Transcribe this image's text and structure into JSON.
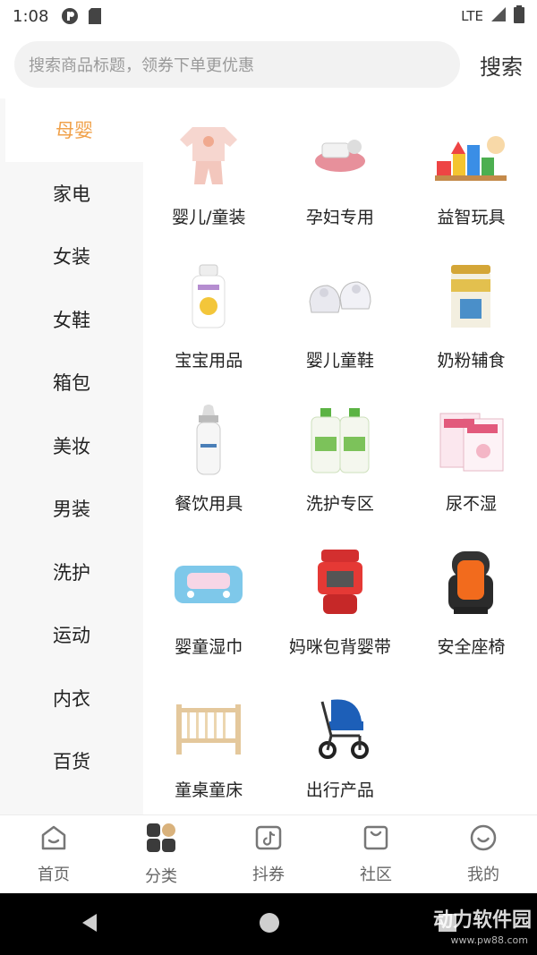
{
  "status_bar": {
    "time": "1:08",
    "network": "LTE"
  },
  "search": {
    "placeholder": "搜索商品标题，领券下单更优惠",
    "button": "搜索"
  },
  "sidebar": {
    "items": [
      {
        "label": "母婴",
        "active": true
      },
      {
        "label": "家电"
      },
      {
        "label": "女装"
      },
      {
        "label": "女鞋"
      },
      {
        "label": "箱包"
      },
      {
        "label": "美妆"
      },
      {
        "label": "男装"
      },
      {
        "label": "洗护"
      },
      {
        "label": "运动"
      },
      {
        "label": "内衣"
      },
      {
        "label": "百货"
      }
    ]
  },
  "categories": [
    {
      "label": "婴儿/童装",
      "icon": "baby-clothes-icon"
    },
    {
      "label": "孕妇专用",
      "icon": "maternity-icon"
    },
    {
      "label": "益智玩具",
      "icon": "toy-blocks-icon"
    },
    {
      "label": "宝宝用品",
      "icon": "baby-lotion-icon"
    },
    {
      "label": "婴儿童鞋",
      "icon": "baby-shoes-icon"
    },
    {
      "label": "奶粉辅食",
      "icon": "milk-powder-icon"
    },
    {
      "label": "餐饮用具",
      "icon": "feeding-bottle-icon"
    },
    {
      "label": "洗护专区",
      "icon": "detergent-icon"
    },
    {
      "label": "尿不湿",
      "icon": "diaper-icon"
    },
    {
      "label": "婴童湿巾",
      "icon": "wet-wipes-icon"
    },
    {
      "label": "妈咪包背婴带",
      "icon": "baby-carrier-icon"
    },
    {
      "label": "安全座椅",
      "icon": "car-seat-icon"
    },
    {
      "label": "童桌童床",
      "icon": "crib-icon"
    },
    {
      "label": "出行产品",
      "icon": "stroller-icon"
    }
  ],
  "bottom_nav": [
    {
      "label": "首页",
      "icon": "home-icon"
    },
    {
      "label": "分类",
      "icon": "category-icon",
      "active": true
    },
    {
      "label": "抖券",
      "icon": "douyin-coupon-icon"
    },
    {
      "label": "社区",
      "icon": "community-bag-icon"
    },
    {
      "label": "我的",
      "icon": "profile-smile-icon"
    }
  ],
  "watermark": {
    "text": "动力软件园",
    "url": "www.pw88.com"
  },
  "colors": {
    "accent": "#f0a14a",
    "sidebar_bg": "#f7f7f7",
    "search_bg": "#f2f2f2"
  }
}
